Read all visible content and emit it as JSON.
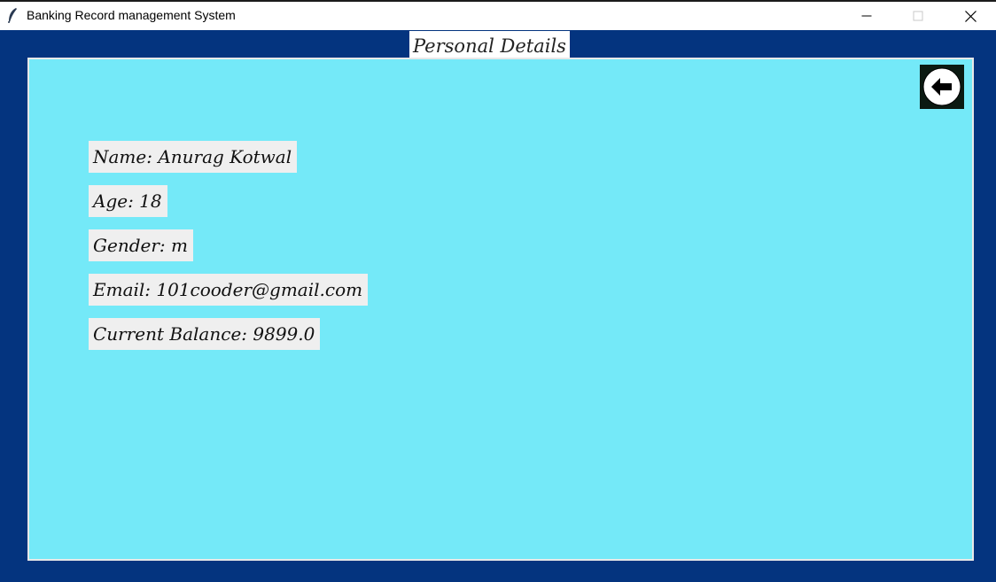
{
  "window": {
    "title": "Banking Record management System",
    "icon": "feather-icon",
    "controls": [
      "minimize-icon",
      "maximize-icon",
      "close-icon"
    ]
  },
  "page": {
    "heading": "Personal Details",
    "back_button_icon": "back-arrow-icon"
  },
  "details": {
    "name": "Name: Anurag Kotwal",
    "age": "Age: 18",
    "gender": "Gender: m",
    "email": "Email: 101cooder@gmail.com",
    "balance": "Current Balance: 9899.0"
  },
  "colors": {
    "outer_background": "#04347f",
    "panel_background": "#74e9f8",
    "label_background": "#efefef"
  }
}
